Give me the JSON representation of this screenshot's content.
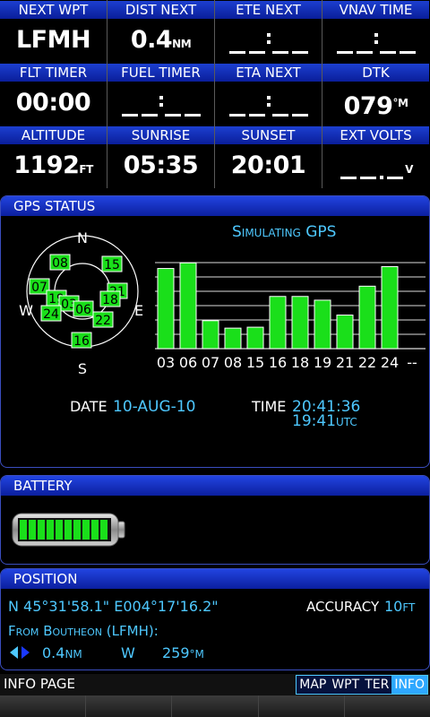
{
  "fields": [
    {
      "label": "NEXT WPT",
      "value": "LFMH",
      "unit": ""
    },
    {
      "label": "DIST NEXT",
      "value": "0.4",
      "unit": "NM"
    },
    {
      "label": "ETE NEXT",
      "value": "__:__",
      "unit": ""
    },
    {
      "label": "VNAV TIME",
      "value": "__:__",
      "unit": ""
    },
    {
      "label": "FLT TIMER",
      "value": "00:00",
      "unit": ""
    },
    {
      "label": "FUEL TIMER",
      "value": "__:__",
      "unit": ""
    },
    {
      "label": "ETA NEXT",
      "value": "__:__",
      "unit": ""
    },
    {
      "label": "DTK",
      "value": "079",
      "unit": "°M"
    },
    {
      "label": "ALTITUDE",
      "value": "1192",
      "unit": "FT"
    },
    {
      "label": "SUNRISE",
      "value": "05:35",
      "unit": ""
    },
    {
      "label": "SUNSET",
      "value": "20:01",
      "unit": ""
    },
    {
      "label": "EXT VOLTS",
      "value": "__._",
      "unit": "V"
    }
  ],
  "gps": {
    "title": "GPS STATUS",
    "status": "Simulating GPS",
    "compass": {
      "n": "N",
      "s": "S",
      "e": "E",
      "w": "W"
    },
    "sky": [
      {
        "id": "08"
      },
      {
        "id": "15"
      },
      {
        "id": "07"
      },
      {
        "id": "21"
      },
      {
        "id": "19"
      },
      {
        "id": "18"
      },
      {
        "id": "03"
      },
      {
        "id": "06"
      },
      {
        "id": "24"
      },
      {
        "id": "22"
      },
      {
        "id": "16"
      }
    ],
    "bars": [
      {
        "prn": "03",
        "strength": 0.86
      },
      {
        "prn": "06",
        "strength": 0.92
      },
      {
        "prn": "07",
        "strength": 0.3
      },
      {
        "prn": "08",
        "strength": 0.22
      },
      {
        "prn": "15",
        "strength": 0.23
      },
      {
        "prn": "16",
        "strength": 0.56
      },
      {
        "prn": "18",
        "strength": 0.56
      },
      {
        "prn": "19",
        "strength": 0.52
      },
      {
        "prn": "21",
        "strength": 0.36
      },
      {
        "prn": "22",
        "strength": 0.67
      },
      {
        "prn": "24",
        "strength": 0.88
      },
      {
        "prn": "--",
        "strength": 0
      }
    ],
    "date_label": "DATE",
    "date": "10-AUG-10",
    "time_label": "TIME",
    "time_local": "20:41:36",
    "time_utc": "19:41",
    "utc_unit": "UTC"
  },
  "battery": {
    "title": "BATTERY",
    "level": 1.0,
    "segments": 10
  },
  "position": {
    "title": "POSITION",
    "coords": "N 45°31'58.1\" E004°17'16.2\"",
    "accuracy_label": "ACCURACY",
    "accuracy_value": "10",
    "accuracy_unit": "FT",
    "from_label": "From Boutheon (LFMH):",
    "dist": "0.4",
    "dist_unit": "NM",
    "dir": "W",
    "bearing": "259",
    "bearing_unit": "°M"
  },
  "footer": {
    "page_name": "INFO PAGE",
    "tabs": [
      "MAP",
      "WPT",
      "TER",
      "INFO"
    ],
    "active_tab": "INFO"
  },
  "colors": {
    "accent": "#4ec8ff",
    "bar": "#1adf1a",
    "header": "#1c3fd0"
  }
}
